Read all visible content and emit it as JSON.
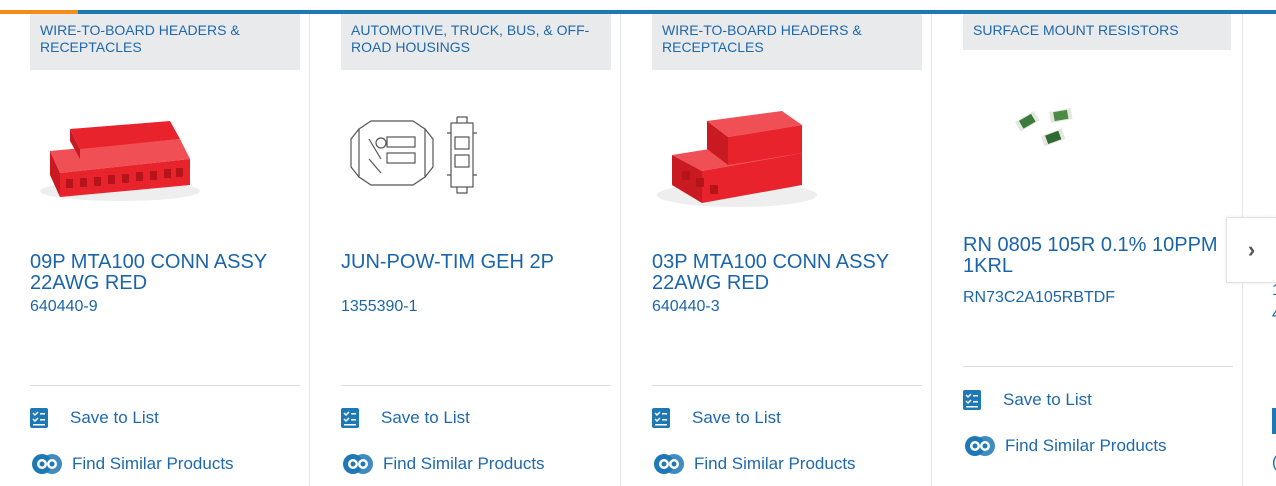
{
  "products": [
    {
      "category": "WIRE-TO-BOARD HEADERS & RECEPTACLES",
      "title": "09P MTA100 CONN ASSY 22AWG RED",
      "part_number": "640440-9",
      "image": "red-9-position-connector-image"
    },
    {
      "category": "AUTOMOTIVE, TRUCK, BUS, & OFF-ROAD HOUSINGS",
      "title": "JUN-POW-TIM GEH 2P",
      "part_number": "1355390-1",
      "image": "housing-line-drawing-image"
    },
    {
      "category": "WIRE-TO-BOARD HEADERS & RECEPTACLES",
      "title": "03P MTA100 CONN ASSY 22AWG RED",
      "part_number": "640440-3",
      "image": "red-3-position-connector-image"
    },
    {
      "category": "SURFACE MOUNT RESISTORS",
      "title": "RN 0805 105R 0.1% 10PPM 1KRL",
      "part_number": "RN73C2A105RBTDF",
      "image": "smd-resistors-image"
    }
  ],
  "actions": {
    "save_label": "Save to List",
    "similar_label": "Find Similar Products"
  },
  "partial_card": {
    "title_fragment_1": "1",
    "title_fragment_2": "4",
    "similar_fragment": "("
  },
  "nav": {
    "next_glyph": "›",
    "next_icon": "chevron-right-icon"
  },
  "colors": {
    "link_blue": "#1a64ab",
    "accent_blue": "#1e78b5",
    "accent_orange": "#f28c1b",
    "category_bg": "#e9eaeb",
    "connector_red": "#e8232b"
  }
}
